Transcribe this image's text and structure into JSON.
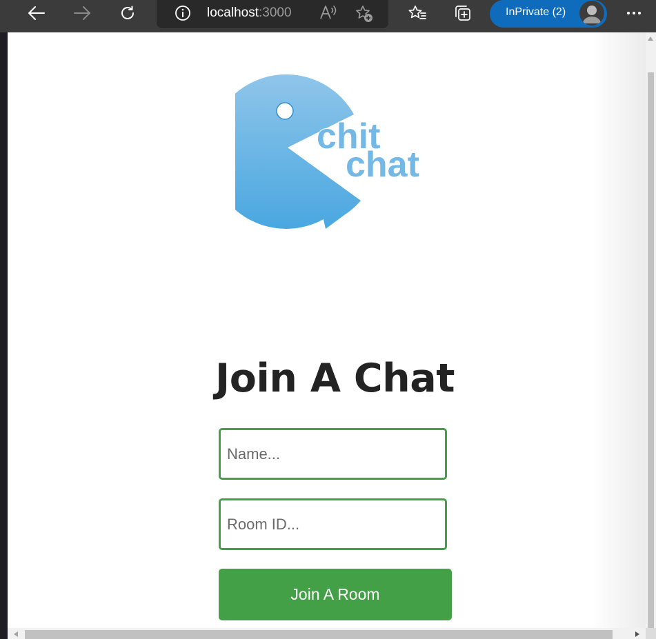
{
  "toolbar": {
    "icons": [
      "back-icon",
      "forward-icon",
      "refresh-icon",
      "info-icon",
      "read-aloud-icon",
      "add-favorite-icon",
      "favorites-icon",
      "collections-icon",
      "more-icon"
    ],
    "address": {
      "host": "localhost",
      "port": ":3000"
    },
    "profile": {
      "label": "InPrivate (2)",
      "accent": "#0f6cbd"
    }
  },
  "page": {
    "logo": {
      "line1": "chit",
      "line2": "chat"
    },
    "heading": "Join A Chat",
    "name_placeholder": "Name...",
    "room_placeholder": "Room ID...",
    "join_button": "Join A Room",
    "accent": "#43a047"
  }
}
